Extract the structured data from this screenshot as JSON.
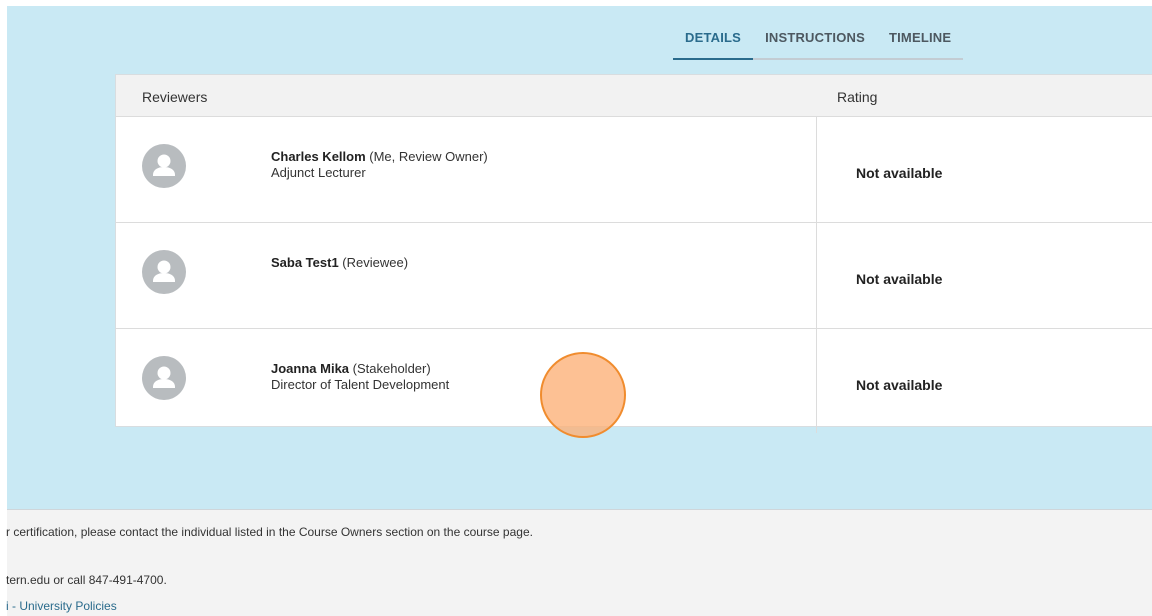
{
  "tabs": [
    {
      "label": "DETAILS",
      "active": true
    },
    {
      "label": "INSTRUCTIONS",
      "active": false
    },
    {
      "label": "TIMELINE",
      "active": false
    }
  ],
  "table": {
    "columns": {
      "reviewers": "Reviewers",
      "rating": "Rating"
    },
    "rows": [
      {
        "name": "Charles Kellom",
        "role_tag": " (Me, Review Owner)",
        "title": "Adjunct Lecturer",
        "rating": "Not available",
        "avatar_icon": "person-icon"
      },
      {
        "name": "Saba Test1",
        "role_tag": " (Reviewee)",
        "title": "",
        "rating": "Not available",
        "avatar_icon": "person-icon"
      },
      {
        "name": "Joanna Mika",
        "role_tag": " (Stakeholder)",
        "title": "Director of Talent Development",
        "rating": "Not available",
        "avatar_icon": "person-icon"
      }
    ]
  },
  "footer": {
    "line1": "r certification, please contact the individual listed in the Course Owners section on the course page.",
    "line2": "tern.edu or call 847-491-4700.",
    "line3": "i - University Policies"
  },
  "colors": {
    "page_background": "#c9e9f4",
    "accent": "#2a6b8c",
    "cursor_highlight": "#f08c2e"
  }
}
